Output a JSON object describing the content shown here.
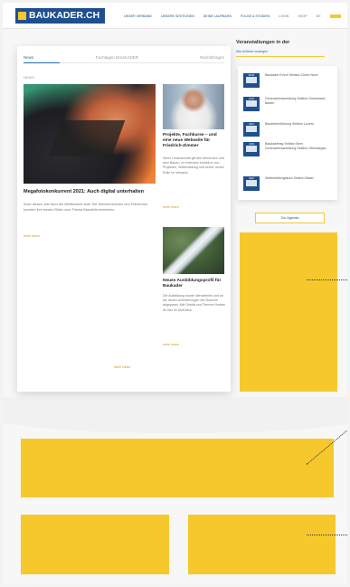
{
  "header": {
    "logo": "BAUKADER.CH",
    "nav": [
      "UNSER VERBAND",
      "UNSERE SEKTIONEN",
      "DEINE LAUFBAHN",
      "FOLGE & STUDIEN",
      "LOGIN",
      "SHOP"
    ],
    "lang": "DE"
  },
  "news": {
    "tabs": [
      "News",
      "Fachtagen BAUKADER",
      "Rechtsfragen"
    ],
    "kicker": "NEWS",
    "main_article": {
      "title": "Megafotokonkurrent 2021: Auch digital unterhalten",
      "excerpt": "Auch dieses Jahr fand der Wettbewerb statt. Die Teilnehmerinnen und Teilnehmer konnten ihre besten Bilder zum Thema Baustelle einreichen.",
      "more": "mehr lesen"
    },
    "side_articles": [
      {
        "title": "Projekte, Fachkurse – und eine neue Webseite für Friedrich-Zimmer",
        "excerpt": "Seine Leidenschaft gilt den Menschen und dem Bauen. Im Interview erzählt er von Projekten, Weiterbildung und seiner neuen Rolle im Verband.",
        "more": "mehr lesen"
      },
      {
        "title": "Neues Ausbildungsprofil für Baukader",
        "excerpt": "Die Ausbildung wurde überarbeitet und an die neuen Anforderungen der Branche angepasst. Alle Details und Termine findest du hier im Überblick.",
        "more": "mehr lesen"
      }
    ],
    "load_more": "Mehr News"
  },
  "events": {
    "title": "Veranstaltungen in der",
    "subtitle": "Alle Anlässe anzeigen",
    "items": [
      {
        "date": "MAR",
        "text": "Baukader Event Sektion Zürich Nord"
      },
      {
        "date": "APR",
        "text": "Generalversammlung Sektion Ostschweiz Baden"
      },
      {
        "date": "MAI",
        "text": "Baustellenführung Sektion Luzern"
      },
      {
        "date": "JUN",
        "text": "Baukadertag Sektion Bern Generalversammlung Sektion Oberaargau"
      },
      {
        "date": "SEP",
        "text": "Weiterbildungskurs Sektion Basel"
      }
    ],
    "agenda_button": "Zur Agenda"
  },
  "colors": {
    "brand_blue": "#1f4f8f",
    "accent_yellow": "#f6c82c",
    "link_blue": "#1f6db5"
  }
}
